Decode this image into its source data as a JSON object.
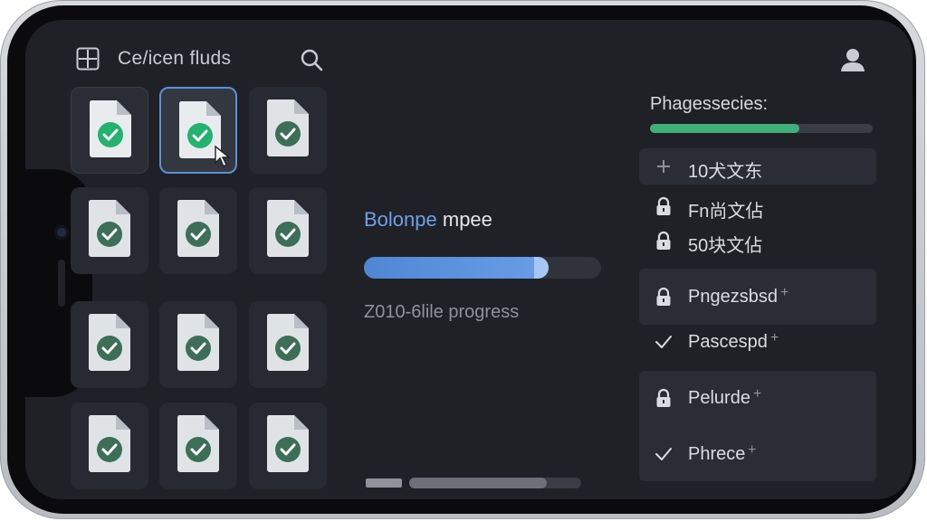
{
  "header": {
    "app_title": "Ce/icen fluds",
    "apps_icon": "apps-icon",
    "search_icon": "search-icon",
    "user_icon": "user-icon"
  },
  "file_grid": {
    "tiles": [
      {
        "state": "completed",
        "icon": "document-check-icon"
      },
      {
        "state": "selected",
        "icon": "document-check-icon"
      },
      {
        "state": "default",
        "icon": "document-check-icon"
      },
      {
        "state": "default",
        "icon": "document-check-icon"
      },
      {
        "state": "default",
        "icon": "document-check-icon"
      },
      {
        "state": "default",
        "icon": "document-check-icon"
      },
      {
        "state": "default",
        "icon": "document-check-icon"
      },
      {
        "state": "default",
        "icon": "document-check-icon"
      },
      {
        "state": "default",
        "icon": "document-check-icon"
      },
      {
        "state": "default",
        "icon": "document-check-icon"
      },
      {
        "state": "default",
        "icon": "document-check-icon"
      },
      {
        "state": "default",
        "icon": "document-check-icon"
      }
    ],
    "check_color_active": "#23b36f",
    "check_color_muted": "#3d6e58"
  },
  "transfer": {
    "label_accent": "Bolonpe",
    "label_rest": " mpee",
    "progress": 0.78,
    "progress_text": "Z010-6lile progress",
    "secondary_progress": 0.8
  },
  "panel": {
    "title": "Phagessecies:",
    "progress": 0.67,
    "items": [
      {
        "icon": "plus-icon",
        "label": "10犬文东",
        "boxed": true
      },
      {
        "icon": "lock-icon",
        "label": "Fn尚文佔",
        "boxed": false
      },
      {
        "icon": "lock-icon",
        "label": "50块文佔",
        "boxed": false
      },
      {
        "icon": "lock-icon",
        "label": "Pngezsbsd",
        "boxed": true,
        "tail": "+"
      },
      {
        "icon": "check-icon",
        "label": "Pascespd",
        "boxed": false,
        "tail": "+"
      },
      {
        "icon": "lock-icon",
        "label": "Pelurde",
        "boxed": false,
        "tail": "+"
      },
      {
        "icon": "check-icon",
        "label": "Phrece",
        "boxed": false,
        "tail": "+"
      }
    ]
  },
  "colors": {
    "screen_bg": "#1f2127",
    "accent_blue": "#5b8fd6",
    "accent_green": "#3fb07a"
  }
}
